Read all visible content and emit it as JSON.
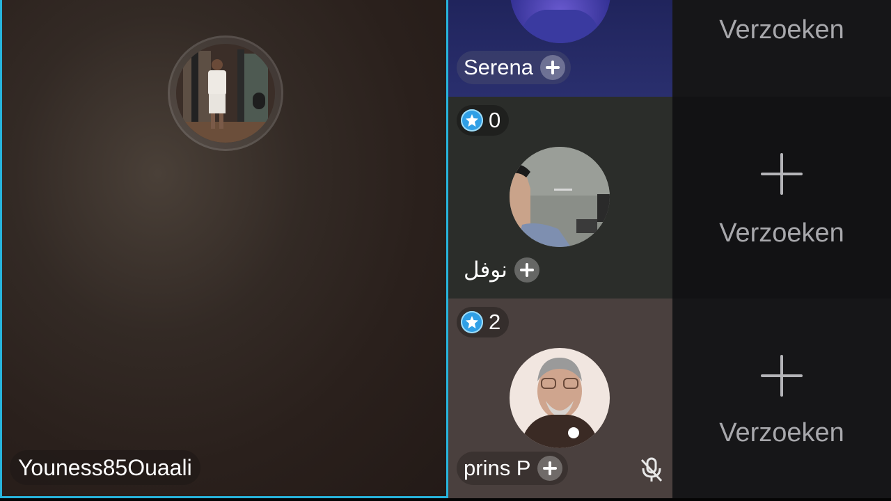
{
  "host": {
    "name": "Youness85Ouaali"
  },
  "guests": [
    {
      "name": "Serena"
    },
    {
      "score": "0",
      "name": "نوفل"
    },
    {
      "score": "2",
      "name": "prins P"
    }
  ],
  "requests": [
    {
      "label": "Verzoeken"
    },
    {
      "label": "Verzoeken"
    },
    {
      "label": "Verzoeken"
    }
  ],
  "colors": {
    "host_border": "#27b4dc",
    "gem": "#2f9fe6"
  },
  "icons": {
    "add": "plus-icon",
    "gem": "gem-icon",
    "mic": "mic-muted-icon",
    "request": "plus-icon"
  }
}
